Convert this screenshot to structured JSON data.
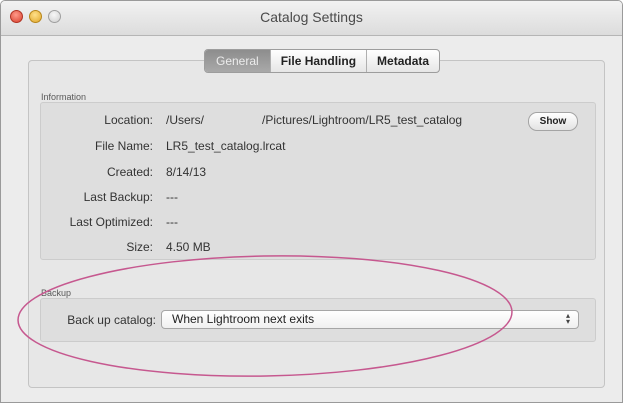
{
  "window": {
    "title": "Catalog Settings",
    "controls": {
      "close": "close-icon",
      "minimize": "minimize-icon",
      "zoom": "zoom-icon"
    }
  },
  "tabs": [
    {
      "label": "General",
      "active": true
    },
    {
      "label": "File Handling",
      "active": false
    },
    {
      "label": "Metadata",
      "active": false
    }
  ],
  "information": {
    "section_label": "Information",
    "location_label": "Location:",
    "location_value_start": "/Users/",
    "location_value_end": "/Pictures/Lightroom/LR5_test_catalog",
    "show_button": "Show",
    "filename_label": "File Name:",
    "filename_value": "LR5_test_catalog.lrcat",
    "created_label": "Created:",
    "created_value": "8/14/13",
    "last_backup_label": "Last Backup:",
    "last_backup_value": "---",
    "last_optimized_label": "Last Optimized:",
    "last_optimized_value": "---",
    "size_label": "Size:",
    "size_value": "4.50 MB"
  },
  "backup": {
    "section_label": "Backup",
    "backup_label": "Back up catalog:",
    "backup_value": "When Lightroom next exits"
  },
  "colors": {
    "annotation_ellipse": "#c6588f"
  }
}
